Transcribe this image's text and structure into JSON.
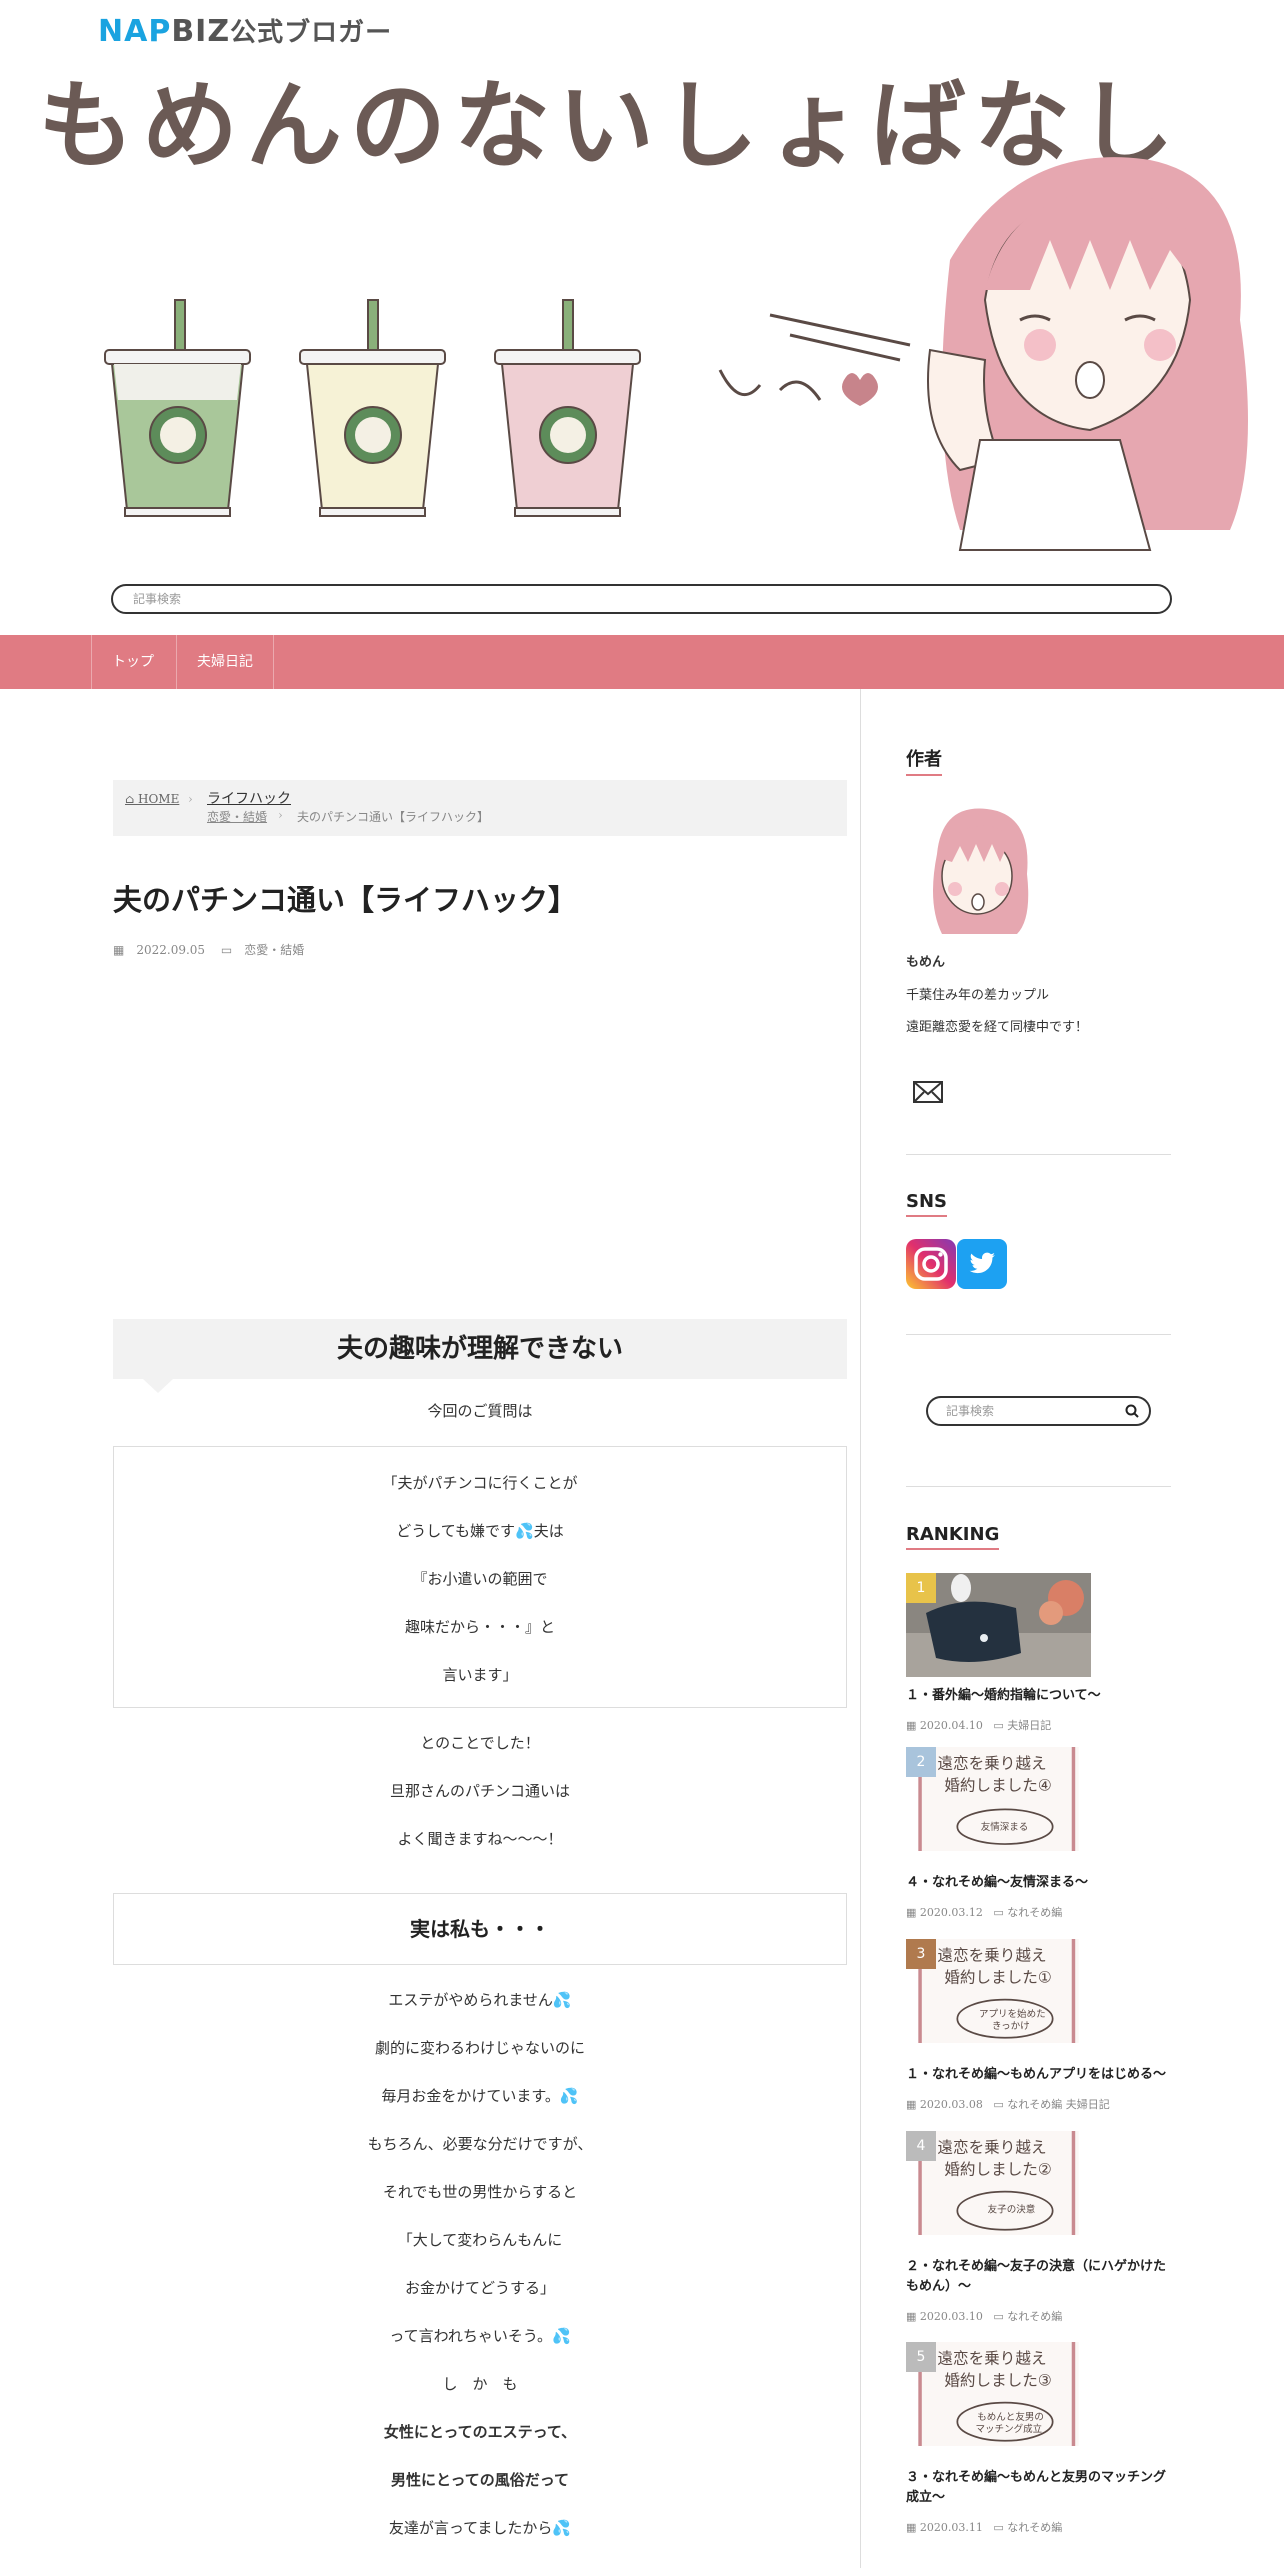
{
  "header": {
    "badge_nap": "NAP",
    "badge_biz": "BIZ",
    "badge_rest": "公式ブロガー",
    "site_title": "もめんのないしょばなし",
    "search_placeholder": "記事検索"
  },
  "nav": {
    "items": [
      {
        "label": "トップ"
      },
      {
        "label": "夫婦日記"
      }
    ]
  },
  "breadcrumb": {
    "home": "HOME",
    "lifehack": "ライフハック",
    "category": "恋愛・結婚",
    "current": "夫のパチンコ通い【ライフハック】"
  },
  "post": {
    "title": "夫のパチンコ通い【ライフハック】",
    "date": "2022.09.05",
    "category": "恋愛・結婚",
    "h2": "夫の趣味が理解できない",
    "intro": "今回のご質問は",
    "quote": [
      "「夫がパチンコに行くことが",
      "どうしても嫌です💦夫は",
      "『お小遣いの範囲で",
      "趣味だから・・・』と",
      "言います」"
    ],
    "after_quote": [
      "とのことでした！",
      "旦那さんのパチンコ通いは",
      "よく聞きますね〜〜〜！"
    ],
    "h3": "実は私も・・・",
    "body_lines": [
      "エステがやめられません💦",
      "劇的に変わるわけじゃないのに",
      "毎月お金をかけています。💦",
      "もちろん、必要な分だけですが、",
      "それでも世の男性からすると",
      "「大して変わらんもんに",
      "お金かけてどうする」",
      "って言われちゃいそう。💦",
      "し　か　も"
    ],
    "strong_lines": [
      "女性にとってのエステって、",
      "男性にとっての風俗だって"
    ],
    "last_line": "友達が言ってましたから💦"
  },
  "sidebar": {
    "author_title": "作者",
    "author_name": "もめん",
    "author_desc1": "千葉住み年の差カップル",
    "author_desc2": "遠距離恋愛を経て同棲中です！",
    "sns_title": "SNS",
    "search_placeholder": "記事検索",
    "ranking_title": "RANKING",
    "ranking": [
      {
        "num": "1",
        "title": "１・番外編〜婚約指輪について〜",
        "date": "2020.04.10",
        "cats": "夫婦日記",
        "color": "#e8c34a"
      },
      {
        "num": "2",
        "title": "４・なれそめ編〜友情深まる〜",
        "date": "2020.03.12",
        "cats": "なれそめ編",
        "color": "#a9c4dc"
      },
      {
        "num": "3",
        "title": "１・なれそめ編〜もめんアプリをはじめる〜",
        "date": "2020.03.08",
        "cats": "なれそめ編 夫婦日記",
        "color": "#b07a4e"
      },
      {
        "num": "4",
        "title": "２・なれそめ編〜友子の決意（にハゲかけたもめん）〜",
        "date": "2020.03.10",
        "cats": "なれそめ編",
        "color": "#bbbbbb"
      },
      {
        "num": "5",
        "title": "３・なれそめ編〜もめんと友男のマッチング成立〜",
        "date": "2020.03.11",
        "cats": "なれそめ編",
        "color": "#bbbbbb"
      }
    ]
  },
  "colors": {
    "nav_bg": "#e07b83",
    "accent": "#e07b83"
  }
}
